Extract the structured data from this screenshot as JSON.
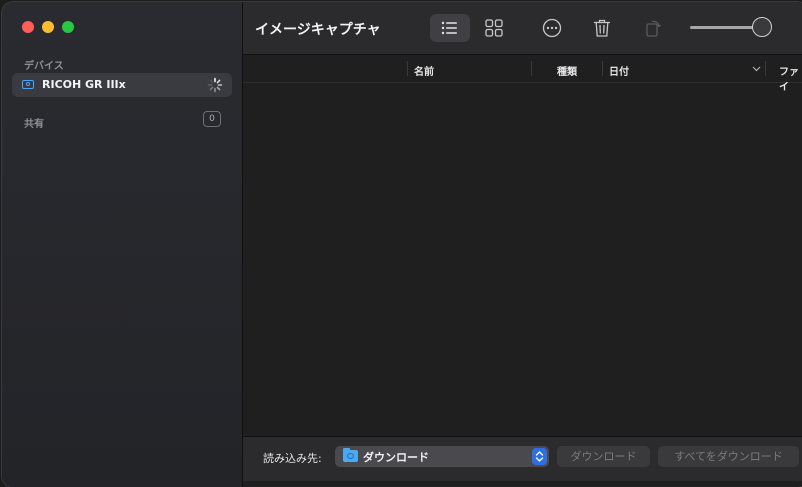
{
  "sidebar": {
    "sections": {
      "devices_label": "デバイス",
      "shared_label": "共有",
      "shared_count": "0"
    },
    "devices": [
      {
        "name": "RICOH GR IIIx",
        "icon": "camera-icon",
        "status": "loading-spinner"
      }
    ]
  },
  "toolbar": {
    "title": "イメージキャプチャ",
    "view_modes": [
      "list-view-icon",
      "grid-view-icon"
    ],
    "active_view": "list",
    "actions": [
      "more-icon",
      "trash-icon",
      "rotate-icon"
    ],
    "thumbnail_size": 0.9
  },
  "table": {
    "columns": [
      "名前",
      "種類",
      "日付",
      "ファイ"
    ],
    "sort_column": "日付",
    "sort_direction": "descending",
    "rows": []
  },
  "footer": {
    "import_to_label": "読み込み先:",
    "destination": "ダウンロード",
    "download_button": "ダウンロード",
    "download_all_button": "すべてをダウンロード"
  },
  "colors": {
    "accent": "#2f6fe0",
    "camera_icon": "#4aa3ff",
    "sidebar_bg": "#2a2b30",
    "main_bg": "#1f1f1f"
  }
}
